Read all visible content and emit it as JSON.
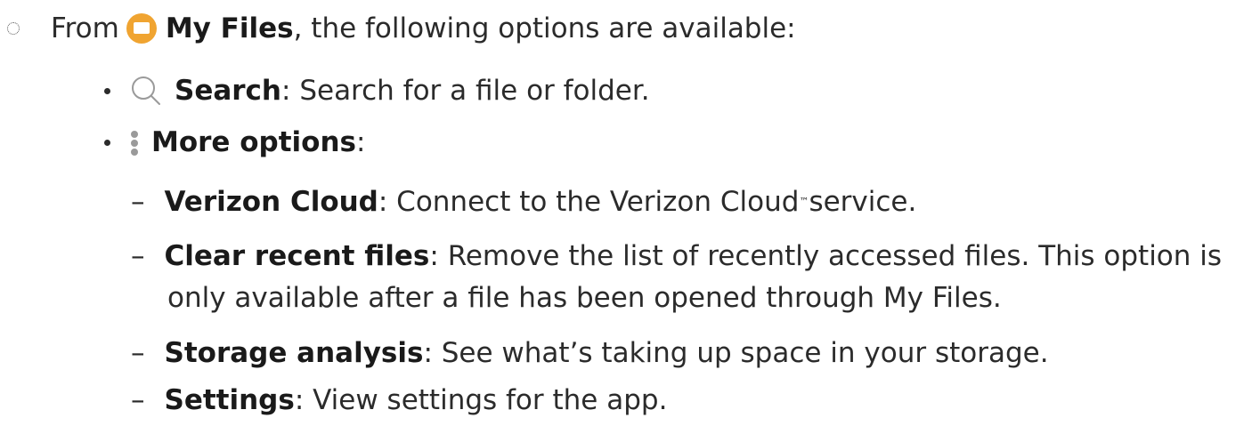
{
  "intro": {
    "prefix": "From ",
    "app_name": "My Files",
    "suffix": ", the following options are available:",
    "app_icon": "my-files-folder-icon",
    "accent_color": "#f0a431"
  },
  "options": [
    {
      "icon": "search-icon",
      "label": "Search",
      "desc": ": Search for a file or folder."
    },
    {
      "icon": "more-options-icon",
      "label": "More options",
      "desc": ":"
    }
  ],
  "more_options": [
    {
      "label": "Verizon Cloud",
      "desc_before_mark": ": Connect to the Verizon Cloud",
      "mark": "™",
      "desc_after_mark": " service."
    },
    {
      "label": "Clear recent files",
      "desc": ": Remove the list of recently accessed files. This option is",
      "desc_cont": "only available after a file has been opened through My Files."
    },
    {
      "label": "Storage analysis",
      "desc": ": See what’s taking up space in your storage."
    },
    {
      "label": "Settings",
      "desc": ": View settings for the app."
    }
  ]
}
